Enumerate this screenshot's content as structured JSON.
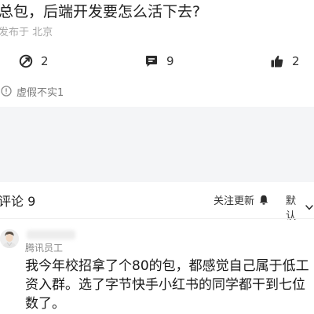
{
  "post": {
    "title": "总包，后端开发要怎么活下去?",
    "meta": "发布于 北京"
  },
  "stats": {
    "share_count": "2",
    "comment_count": "9",
    "like_count": "2"
  },
  "report": {
    "label": "虚假不实1"
  },
  "comments": {
    "title": "评论 9",
    "follow_label": "关注更新",
    "sort_label": "默认",
    "items": [
      {
        "company": "腾讯员工",
        "text": "我今年校招拿了个80的包，都感觉自己属于低工资入群。选了字节快手小红书的同学都干到七位数了。"
      }
    ]
  },
  "icons": {
    "share": "share-icon",
    "comment": "comment-icon",
    "like": "thumbs-up-icon",
    "report": "warning-icon",
    "bell": "bell-icon",
    "chevron": "chevron-down-icon"
  },
  "colors": {
    "icon": "#2b2b2b",
    "muted": "#a8a8a8",
    "band": "#f4f5f7"
  }
}
